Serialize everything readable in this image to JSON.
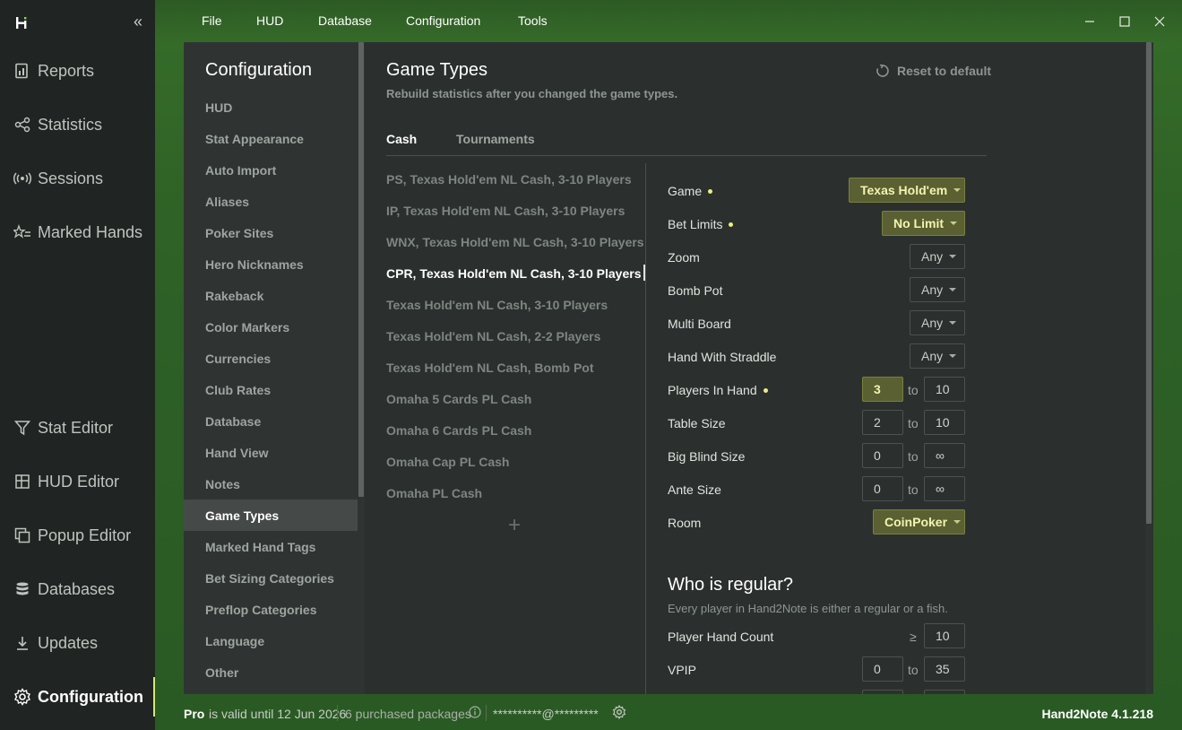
{
  "app": {
    "name": "Hand2Note",
    "version_label": "Hand2Note 4.1.218",
    "colors": {
      "accent": "#e8f07a",
      "highlight_bg": "#5a6031",
      "green_bg": "#2e6226"
    }
  },
  "menu": [
    "File",
    "HUD",
    "Database",
    "Configuration",
    "Tools"
  ],
  "leftnav": {
    "collapse_icon": "double-chevron-left-icon",
    "items": [
      {
        "label": "Reports",
        "icon": "reports-icon"
      },
      {
        "label": "Statistics",
        "icon": "share-nodes-icon"
      },
      {
        "label": "Sessions",
        "icon": "broadcast-icon"
      },
      {
        "label": "Marked Hands",
        "icon": "star-list-icon"
      },
      {
        "label": "Stat Editor",
        "icon": "filter-icon"
      },
      {
        "label": "HUD Editor",
        "icon": "hud-grid-icon"
      },
      {
        "label": "Popup Editor",
        "icon": "popup-icon"
      },
      {
        "label": "Databases",
        "icon": "database-icon"
      },
      {
        "label": "Updates",
        "icon": "download-icon"
      },
      {
        "label": "Configuration",
        "icon": "gear-icon"
      }
    ]
  },
  "config": {
    "title": "Configuration",
    "items": [
      "HUD",
      "Stat Appearance",
      "Auto Import",
      "Aliases",
      "Poker Sites",
      "Hero Nicknames",
      "Rakeback",
      "Color Markers",
      "Currencies",
      "Club Rates",
      "Database",
      "Hand View",
      "Notes",
      "Game Types",
      "Marked Hand Tags",
      "Bet Sizing Categories",
      "Preflop Categories",
      "Language",
      "Other"
    ]
  },
  "game_types": {
    "title": "Game Types",
    "subtitle": "Rebuild statistics after you changed the game types.",
    "reset_label": "Reset to default",
    "tabs": [
      "Cash",
      "Tournaments"
    ],
    "list": [
      "PS, Texas Hold'em NL Cash, 3-10 Players",
      "IP, Texas Hold'em NL Cash, 3-10 Players",
      "WNX, Texas Hold'em NL Cash, 3-10 Players",
      "CPR, Texas Hold'em NL Cash, 3-10 Players",
      "Texas Hold'em NL Cash, 3-10 Players",
      "Texas Hold'em NL Cash, 2-2 Players",
      "Texas Hold'em NL Cash, Bomb Pot",
      "Omaha 5 Cards PL Cash",
      "Omaha 6 Cards PL Cash",
      "Omaha Cap PL Cash",
      "Omaha PL Cash"
    ],
    "add_symbol": "+",
    "fields": {
      "game": {
        "label": "Game",
        "value": "Texas Hold'em"
      },
      "bet_limits": {
        "label": "Bet Limits",
        "value": "No Limit"
      },
      "zoom": {
        "label": "Zoom",
        "value": "Any"
      },
      "bomb_pot": {
        "label": "Bomb Pot",
        "value": "Any"
      },
      "multi_board": {
        "label": "Multi Board",
        "value": "Any"
      },
      "straddle": {
        "label": "Hand With Straddle",
        "value": "Any"
      },
      "players_in_hand": {
        "label": "Players In Hand",
        "from": "3",
        "to": "10"
      },
      "table_size": {
        "label": "Table Size",
        "from": "2",
        "to": "10"
      },
      "big_blind": {
        "label": "Big Blind Size",
        "from": "0",
        "to": "∞"
      },
      "ante": {
        "label": "Ante Size",
        "from": "0",
        "to": "∞"
      },
      "room": {
        "label": "Room",
        "value": "CoinPoker"
      }
    },
    "to_label": "to",
    "regular": {
      "title": "Who is regular?",
      "subtitle": "Every player in Hand2Note is either a regular or a fish.",
      "hand_count": {
        "label": "Player Hand Count",
        "op": "≥",
        "value": "10"
      },
      "vpip": {
        "label": "VPIP",
        "from": "0",
        "to": "35"
      }
    }
  },
  "status": {
    "pro": "Pro",
    "valid": "is valid until 12 Jun 2026",
    "packages": "6 purchased packages",
    "email": "**********@*********"
  }
}
